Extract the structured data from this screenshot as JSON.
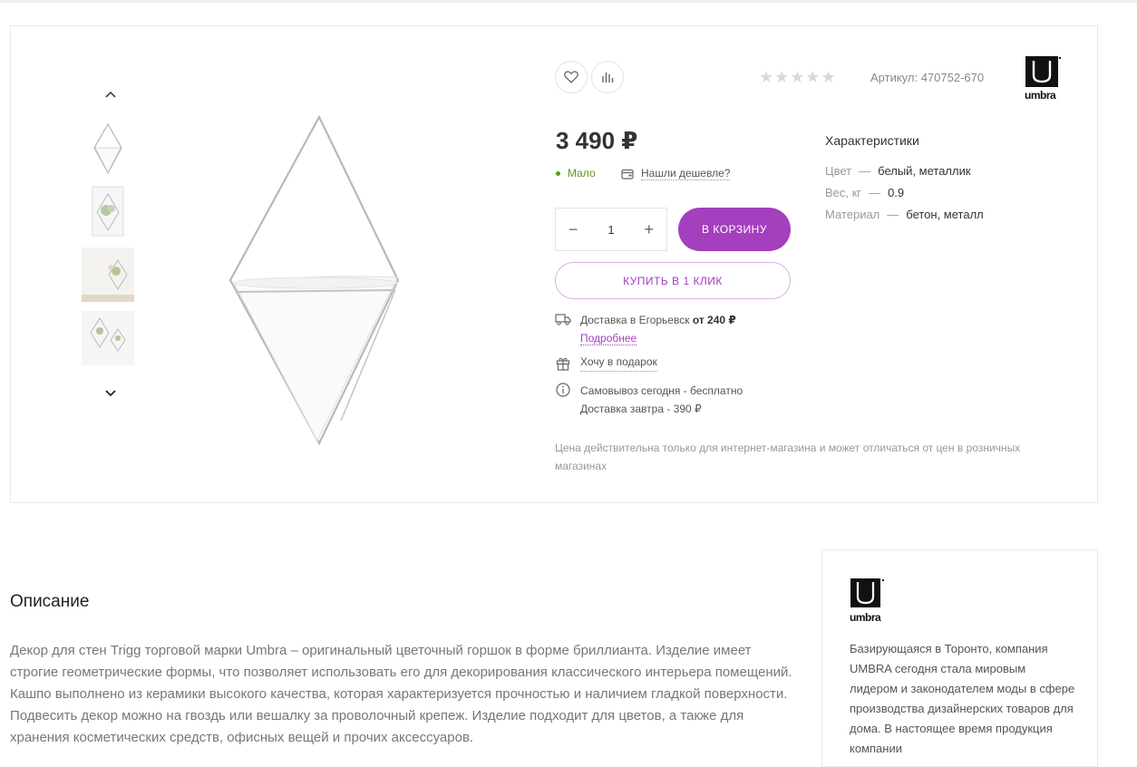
{
  "gallery": {
    "up_icon": "chevron-up-icon",
    "down_icon": "chevron-down-icon",
    "thumbnails": [
      "thumb-diamond",
      "thumb-box",
      "thumb-wall-plant",
      "thumb-wall-set"
    ]
  },
  "product": {
    "article": "Артикул: 470752-670",
    "rating": "★★★★★",
    "rating_value": 0,
    "price": "3 490 ₽",
    "stock": "Мало",
    "cheaper_link": "Нашли дешевле?",
    "quantity": "1",
    "minus": "−",
    "plus": "+",
    "cart_button": "В КОРЗИНУ",
    "oneclick_button": "КУПИТЬ В 1 КЛИК",
    "delivery_prefix": "Доставка в Егорьевск",
    "delivery_price": "от 240 ₽",
    "delivery_more": "Подробнее",
    "gift_link": "Хочу в подарок",
    "pickup": "Самовывоз сегодня - бесплатно",
    "delivery_tomorrow": "Доставка завтра - 390 ₽",
    "price_note": "Цена действительна только для интернет-магазина и может отличаться от цен в розничных магазинах"
  },
  "characteristics": {
    "title": "Характеристики",
    "rows": [
      {
        "label": "Цвет",
        "dash": "—",
        "value": "белый, металлик"
      },
      {
        "label": "Вес, кг",
        "dash": "—",
        "value": "0.9"
      },
      {
        "label": "Материал",
        "dash": "—",
        "value": "бетон, металл"
      }
    ]
  },
  "description": {
    "title": "Описание",
    "text": "Декор для стен Trigg торговой марки Umbra – оригинальный цветочный горшок в форме бриллианта. Изделие имеет строгие геометрические формы, что позволяет использовать его для декорирования классического интерьера помещений. Кашпо выполнено из керамики высокого качества, которая характеризуется прочностью и наличием гладкой поверхности. Подвесить декор можно на гвоздь или вешалку за проволочный крепеж. Изделие подходит для цветов, а также для хранения косметических средств, офисных вещей и прочих аксессуаров."
  },
  "brand": {
    "name": "umbra",
    "text": "Базирующаяся в Торонто, компания UMBRA сегодня стала мировым лидером и законодателем моды в сфере производства дизайнерских товаров для дома. В настоящее время продукция компании"
  },
  "colors": {
    "accent": "#a43fbe",
    "stock_green": "#5c9b13"
  }
}
